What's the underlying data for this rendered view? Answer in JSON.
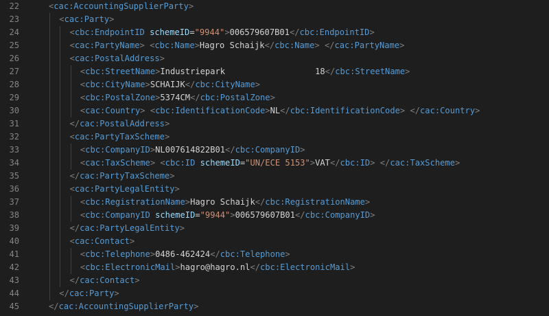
{
  "editor": {
    "colors": {
      "background": "#1e1e1e",
      "line_number": "#858585",
      "tag": "#569cd6",
      "bracket": "#808080",
      "attribute": "#9cdcfe",
      "string": "#ce9178",
      "text": "#d4d4d4",
      "indent_guide": "#404040"
    },
    "lines": [
      {
        "num": "22",
        "indent": 1,
        "tokens": [
          {
            "t": "b",
            "v": "<"
          },
          {
            "t": "t",
            "v": "cac:AccountingSupplierParty"
          },
          {
            "t": "b",
            "v": ">"
          }
        ]
      },
      {
        "num": "23",
        "indent": 2,
        "tokens": [
          {
            "t": "b",
            "v": "<"
          },
          {
            "t": "t",
            "v": "cac:Party"
          },
          {
            "t": "b",
            "v": ">"
          }
        ]
      },
      {
        "num": "24",
        "indent": 3,
        "tokens": [
          {
            "t": "b",
            "v": "<"
          },
          {
            "t": "t",
            "v": "cbc:EndpointID"
          },
          {
            "t": "x",
            "v": " "
          },
          {
            "t": "a",
            "v": "schemeID"
          },
          {
            "t": "x",
            "v": "="
          },
          {
            "t": "s",
            "v": "\"9944\""
          },
          {
            "t": "b",
            "v": ">"
          },
          {
            "t": "x",
            "v": "006579607B01"
          },
          {
            "t": "b",
            "v": "</"
          },
          {
            "t": "t",
            "v": "cbc:EndpointID"
          },
          {
            "t": "b",
            "v": ">"
          }
        ]
      },
      {
        "num": "25",
        "indent": 3,
        "tokens": [
          {
            "t": "b",
            "v": "<"
          },
          {
            "t": "t",
            "v": "cac:PartyName"
          },
          {
            "t": "b",
            "v": ">"
          },
          {
            "t": "x",
            "v": " "
          },
          {
            "t": "b",
            "v": "<"
          },
          {
            "t": "t",
            "v": "cbc:Name"
          },
          {
            "t": "b",
            "v": ">"
          },
          {
            "t": "x",
            "v": "Hagro Schaijk"
          },
          {
            "t": "b",
            "v": "</"
          },
          {
            "t": "t",
            "v": "cbc:Name"
          },
          {
            "t": "b",
            "v": ">"
          },
          {
            "t": "x",
            "v": " "
          },
          {
            "t": "b",
            "v": "</"
          },
          {
            "t": "t",
            "v": "cac:PartyName"
          },
          {
            "t": "b",
            "v": ">"
          }
        ]
      },
      {
        "num": "26",
        "indent": 3,
        "tokens": [
          {
            "t": "b",
            "v": "<"
          },
          {
            "t": "t",
            "v": "cac:PostalAddress"
          },
          {
            "t": "b",
            "v": ">"
          }
        ]
      },
      {
        "num": "27",
        "indent": 4,
        "tokens": [
          {
            "t": "b",
            "v": "<"
          },
          {
            "t": "t",
            "v": "cbc:StreetName"
          },
          {
            "t": "b",
            "v": ">"
          },
          {
            "t": "x",
            "v": "Industriepark                  18"
          },
          {
            "t": "b",
            "v": "</"
          },
          {
            "t": "t",
            "v": "cbc:StreetName"
          },
          {
            "t": "b",
            "v": ">"
          }
        ]
      },
      {
        "num": "28",
        "indent": 4,
        "tokens": [
          {
            "t": "b",
            "v": "<"
          },
          {
            "t": "t",
            "v": "cbc:CityName"
          },
          {
            "t": "b",
            "v": ">"
          },
          {
            "t": "x",
            "v": "SCHAIJK"
          },
          {
            "t": "b",
            "v": "</"
          },
          {
            "t": "t",
            "v": "cbc:CityName"
          },
          {
            "t": "b",
            "v": ">"
          }
        ]
      },
      {
        "num": "29",
        "indent": 4,
        "tokens": [
          {
            "t": "b",
            "v": "<"
          },
          {
            "t": "t",
            "v": "cbc:PostalZone"
          },
          {
            "t": "b",
            "v": ">"
          },
          {
            "t": "x",
            "v": "5374CM"
          },
          {
            "t": "b",
            "v": "</"
          },
          {
            "t": "t",
            "v": "cbc:PostalZone"
          },
          {
            "t": "b",
            "v": ">"
          }
        ]
      },
      {
        "num": "30",
        "indent": 4,
        "tokens": [
          {
            "t": "b",
            "v": "<"
          },
          {
            "t": "t",
            "v": "cac:Country"
          },
          {
            "t": "b",
            "v": ">"
          },
          {
            "t": "x",
            "v": " "
          },
          {
            "t": "b",
            "v": "<"
          },
          {
            "t": "t",
            "v": "cbc:IdentificationCode"
          },
          {
            "t": "b",
            "v": ">"
          },
          {
            "t": "x",
            "v": "NL"
          },
          {
            "t": "b",
            "v": "</"
          },
          {
            "t": "t",
            "v": "cbc:IdentificationCode"
          },
          {
            "t": "b",
            "v": ">"
          },
          {
            "t": "x",
            "v": " "
          },
          {
            "t": "b",
            "v": "</"
          },
          {
            "t": "t",
            "v": "cac:Country"
          },
          {
            "t": "b",
            "v": ">"
          }
        ]
      },
      {
        "num": "31",
        "indent": 3,
        "tokens": [
          {
            "t": "b",
            "v": "</"
          },
          {
            "t": "t",
            "v": "cac:PostalAddress"
          },
          {
            "t": "b",
            "v": ">"
          }
        ]
      },
      {
        "num": "32",
        "indent": 3,
        "tokens": [
          {
            "t": "b",
            "v": "<"
          },
          {
            "t": "t",
            "v": "cac:PartyTaxScheme"
          },
          {
            "t": "b",
            "v": ">"
          }
        ]
      },
      {
        "num": "33",
        "indent": 4,
        "tokens": [
          {
            "t": "b",
            "v": "<"
          },
          {
            "t": "t",
            "v": "cbc:CompanyID"
          },
          {
            "t": "b",
            "v": ">"
          },
          {
            "t": "x",
            "v": "NL007614822B01"
          },
          {
            "t": "b",
            "v": "</"
          },
          {
            "t": "t",
            "v": "cbc:CompanyID"
          },
          {
            "t": "b",
            "v": ">"
          }
        ]
      },
      {
        "num": "34",
        "indent": 4,
        "tokens": [
          {
            "t": "b",
            "v": "<"
          },
          {
            "t": "t",
            "v": "cac:TaxScheme"
          },
          {
            "t": "b",
            "v": ">"
          },
          {
            "t": "x",
            "v": " "
          },
          {
            "t": "b",
            "v": "<"
          },
          {
            "t": "t",
            "v": "cbc:ID"
          },
          {
            "t": "x",
            "v": " "
          },
          {
            "t": "a",
            "v": "schemeID"
          },
          {
            "t": "x",
            "v": "="
          },
          {
            "t": "s",
            "v": "\"UN/ECE 5153\""
          },
          {
            "t": "b",
            "v": ">"
          },
          {
            "t": "x",
            "v": "VAT"
          },
          {
            "t": "b",
            "v": "</"
          },
          {
            "t": "t",
            "v": "cbc:ID"
          },
          {
            "t": "b",
            "v": ">"
          },
          {
            "t": "x",
            "v": " "
          },
          {
            "t": "b",
            "v": "</"
          },
          {
            "t": "t",
            "v": "cac:TaxScheme"
          },
          {
            "t": "b",
            "v": ">"
          }
        ]
      },
      {
        "num": "35",
        "indent": 3,
        "tokens": [
          {
            "t": "b",
            "v": "</"
          },
          {
            "t": "t",
            "v": "cac:PartyTaxScheme"
          },
          {
            "t": "b",
            "v": ">"
          }
        ]
      },
      {
        "num": "36",
        "indent": 3,
        "tokens": [
          {
            "t": "b",
            "v": "<"
          },
          {
            "t": "t",
            "v": "cac:PartyLegalEntity"
          },
          {
            "t": "b",
            "v": ">"
          }
        ]
      },
      {
        "num": "37",
        "indent": 4,
        "tokens": [
          {
            "t": "b",
            "v": "<"
          },
          {
            "t": "t",
            "v": "cbc:RegistrationName"
          },
          {
            "t": "b",
            "v": ">"
          },
          {
            "t": "x",
            "v": "Hagro Schaijk"
          },
          {
            "t": "b",
            "v": "</"
          },
          {
            "t": "t",
            "v": "cbc:RegistrationName"
          },
          {
            "t": "b",
            "v": ">"
          }
        ]
      },
      {
        "num": "38",
        "indent": 4,
        "tokens": [
          {
            "t": "b",
            "v": "<"
          },
          {
            "t": "t",
            "v": "cbc:CompanyID"
          },
          {
            "t": "x",
            "v": " "
          },
          {
            "t": "a",
            "v": "schemeID"
          },
          {
            "t": "x",
            "v": "="
          },
          {
            "t": "s",
            "v": "\"9944\""
          },
          {
            "t": "b",
            "v": ">"
          },
          {
            "t": "x",
            "v": "006579607B01"
          },
          {
            "t": "b",
            "v": "</"
          },
          {
            "t": "t",
            "v": "cbc:CompanyID"
          },
          {
            "t": "b",
            "v": ">"
          }
        ]
      },
      {
        "num": "39",
        "indent": 3,
        "tokens": [
          {
            "t": "b",
            "v": "</"
          },
          {
            "t": "t",
            "v": "cac:PartyLegalEntity"
          },
          {
            "t": "b",
            "v": ">"
          }
        ]
      },
      {
        "num": "40",
        "indent": 3,
        "tokens": [
          {
            "t": "b",
            "v": "<"
          },
          {
            "t": "t",
            "v": "cac:Contact"
          },
          {
            "t": "b",
            "v": ">"
          }
        ]
      },
      {
        "num": "41",
        "indent": 4,
        "tokens": [
          {
            "t": "b",
            "v": "<"
          },
          {
            "t": "t",
            "v": "cbc:Telephone"
          },
          {
            "t": "b",
            "v": ">"
          },
          {
            "t": "x",
            "v": "0486-462424"
          },
          {
            "t": "b",
            "v": "</"
          },
          {
            "t": "t",
            "v": "cbc:Telephone"
          },
          {
            "t": "b",
            "v": ">"
          }
        ]
      },
      {
        "num": "42",
        "indent": 4,
        "tokens": [
          {
            "t": "b",
            "v": "<"
          },
          {
            "t": "t",
            "v": "cbc:ElectronicMail"
          },
          {
            "t": "b",
            "v": ">"
          },
          {
            "t": "x",
            "v": "hagro@hagro.nl"
          },
          {
            "t": "b",
            "v": "</"
          },
          {
            "t": "t",
            "v": "cbc:ElectronicMail"
          },
          {
            "t": "b",
            "v": ">"
          }
        ]
      },
      {
        "num": "43",
        "indent": 3,
        "tokens": [
          {
            "t": "b",
            "v": "</"
          },
          {
            "t": "t",
            "v": "cac:Contact"
          },
          {
            "t": "b",
            "v": ">"
          }
        ]
      },
      {
        "num": "44",
        "indent": 2,
        "tokens": [
          {
            "t": "b",
            "v": "</"
          },
          {
            "t": "t",
            "v": "cac:Party"
          },
          {
            "t": "b",
            "v": ">"
          }
        ]
      },
      {
        "num": "45",
        "indent": 1,
        "tokens": [
          {
            "t": "b",
            "v": "</"
          },
          {
            "t": "t",
            "v": "cac:AccountingSupplierParty"
          },
          {
            "t": "b",
            "v": ">"
          }
        ]
      }
    ]
  }
}
